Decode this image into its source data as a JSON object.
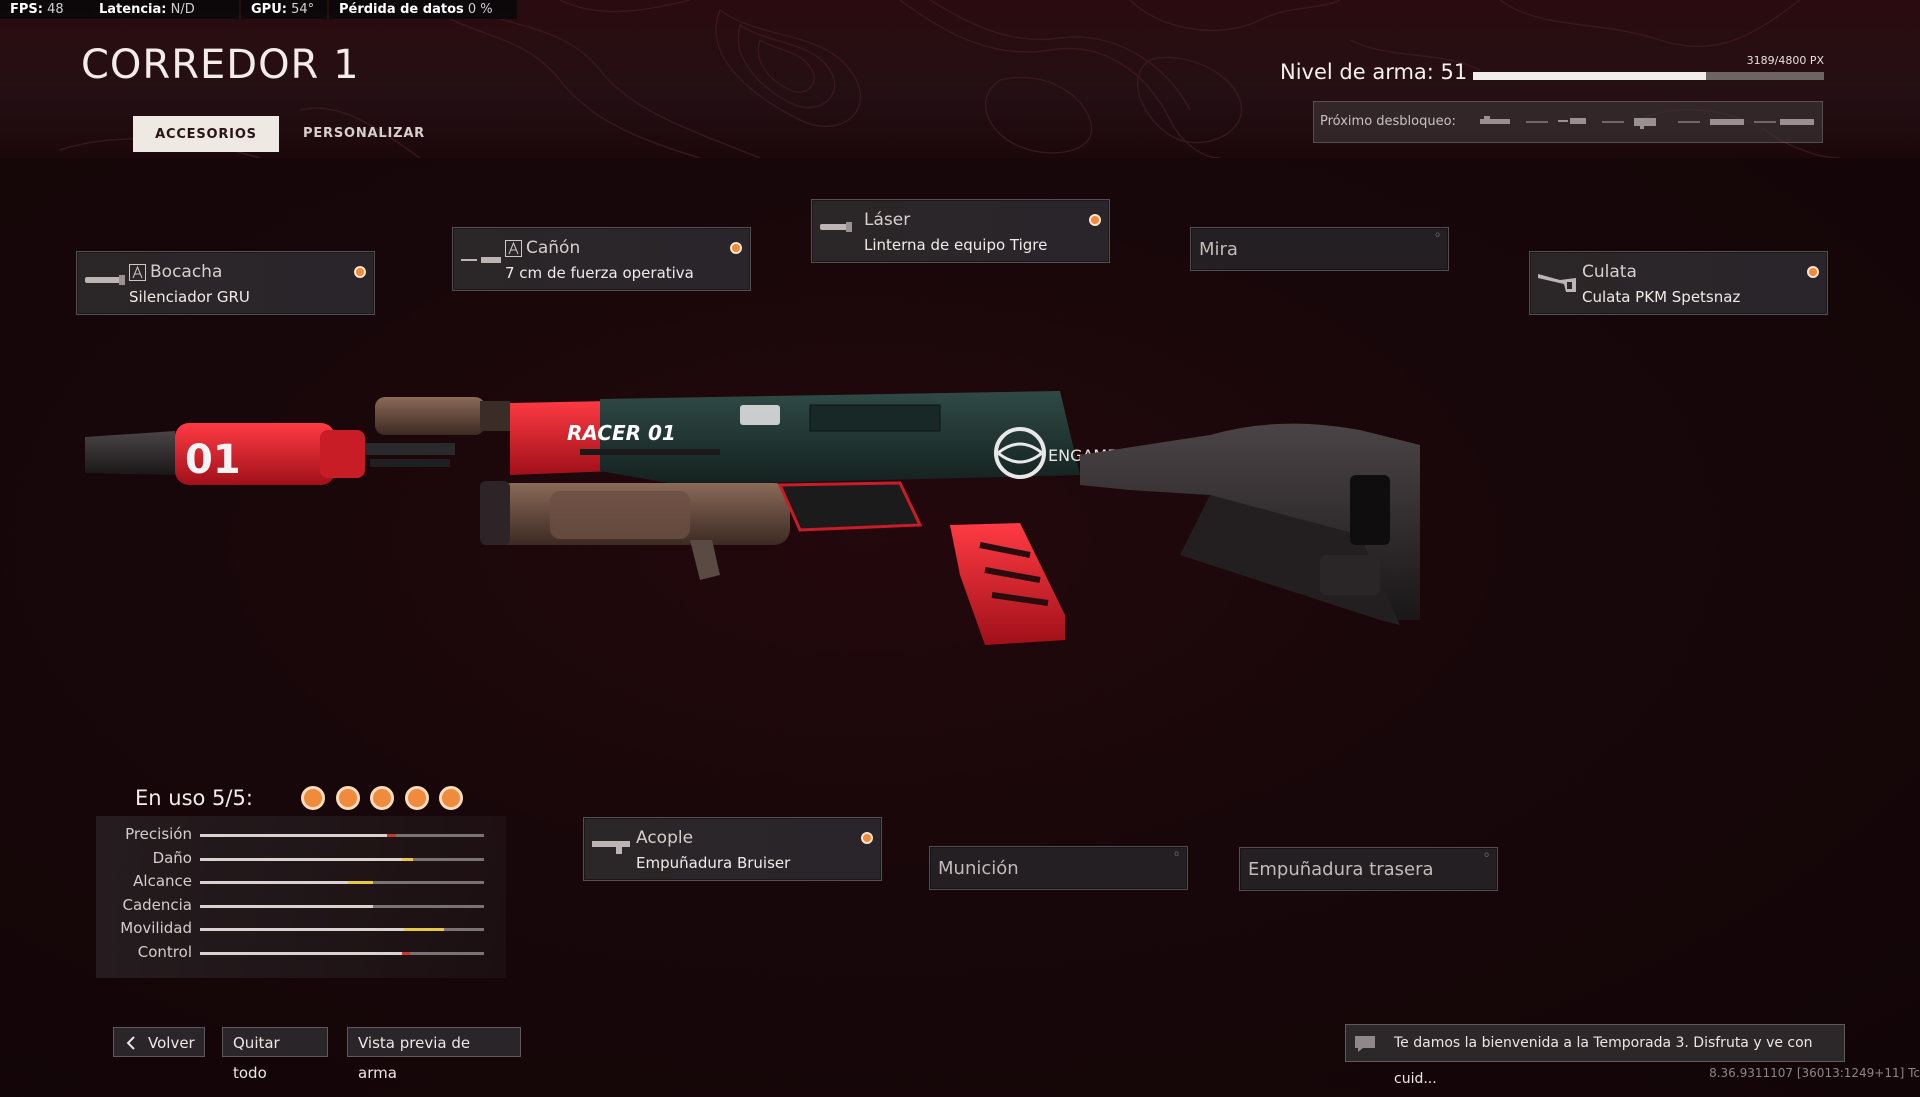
{
  "perf": {
    "fps_label": "FPS:",
    "fps_value": "48",
    "latency_label": "Latencia:",
    "latency_value": "N/D",
    "gpu_label": "GPU:",
    "gpu_value": "54°",
    "loss_label": "Pérdida de datos",
    "loss_value": "0 %"
  },
  "header": {
    "title": "CORREDOR 1",
    "tabs": [
      {
        "label": "ACCESORIOS",
        "active": true
      },
      {
        "label": "PERSONALIZAR",
        "active": false
      }
    ],
    "level_label": "Nivel de arma: 51",
    "xp_text": "3189/4800 PX",
    "xp_progress": 0.664,
    "next_unlock_label": "Próximo desbloqueo:"
  },
  "slots": {
    "muzzle": {
      "name": "Bocacha",
      "value": "Silenciador GRU",
      "equipped": true
    },
    "barrel": {
      "name": "Cañón",
      "value": "7 cm de fuerza operativa",
      "equipped": true
    },
    "laser": {
      "name": "Láser",
      "value": "Linterna de equipo Tigre",
      "equipped": true
    },
    "optic": {
      "name": "Mira",
      "value": "",
      "equipped": false
    },
    "stock": {
      "name": "Culata",
      "value": "Culata PKM Spetsnaz",
      "equipped": true
    },
    "underbarrel": {
      "name": "Acople",
      "value": "Empuñadura Bruiser",
      "equipped": true
    },
    "ammo": {
      "name": "Munición",
      "value": "",
      "equipped": false
    },
    "rear_grip": {
      "name": "Empuñadura trasera",
      "value": "",
      "equipped": false
    }
  },
  "usage": {
    "label": "En uso 5/5:",
    "used": 5,
    "max": 5
  },
  "stats": [
    {
      "label": "Precisión",
      "base": 0.66,
      "mod": 0.03,
      "mod_color": "#c9372c"
    },
    {
      "label": "Daño",
      "base": 0.71,
      "mod": 0.04,
      "mod_color": "#e6c84a"
    },
    {
      "label": "Alcance",
      "base": 0.52,
      "mod": 0.09,
      "mod_color": "#e6c84a"
    },
    {
      "label": "Cadencia",
      "base": 0.61,
      "mod": 0.0,
      "mod_color": "#e6c84a"
    },
    {
      "label": "Movilidad",
      "base": 0.72,
      "mod": 0.14,
      "mod_color": "#e6c84a"
    },
    {
      "label": "Control",
      "base": 0.71,
      "mod": 0.03,
      "mod_color": "#c9372c"
    }
  ],
  "bottom": {
    "back": "Volver",
    "remove_all": "Quitar todo",
    "preview": "Vista previa de arma",
    "ticker": "Te damos la bienvenida a la Temporada 3. Disfruta y ve con cuid..."
  },
  "version": "8.36.9311107 [36013:1249+11] Tc",
  "colors": {
    "accent": "#f08a3c",
    "background": "#18070a",
    "weapon_red": "#d11f2a",
    "weapon_green": "#1f3330"
  }
}
